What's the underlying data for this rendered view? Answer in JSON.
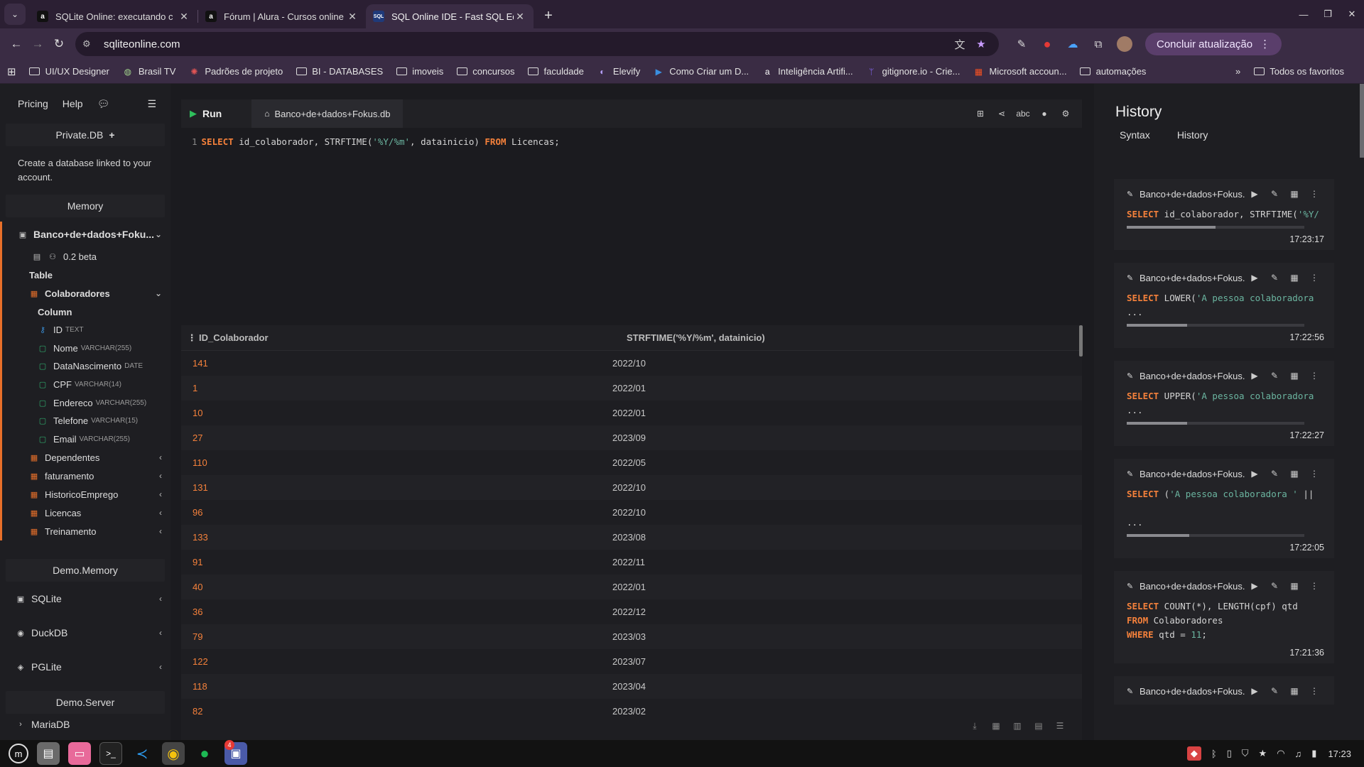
{
  "browser": {
    "tabs": [
      {
        "label": "SQLite Online: executando c",
        "favicon": "a",
        "active": false
      },
      {
        "label": "Fórum | Alura - Cursos online",
        "favicon": "a",
        "active": false
      },
      {
        "label": "SQL Online IDE - Fast SQL Ed",
        "favicon": "SQL",
        "active": true
      }
    ],
    "url": "sqliteonline.com",
    "update_button": "Concluir atualização",
    "bookmarks": [
      {
        "label": "UI/UX Designer",
        "icon": "folder-icon"
      },
      {
        "label": "Brasil TV",
        "icon": "tv-icon"
      },
      {
        "label": "Padrões de projeto",
        "icon": "pattern-icon"
      },
      {
        "label": "BI - DATABASES",
        "icon": "folder-icon"
      },
      {
        "label": "imoveis",
        "icon": "folder-icon"
      },
      {
        "label": "concursos",
        "icon": "folder-icon"
      },
      {
        "label": "faculdade",
        "icon": "folder-icon"
      },
      {
        "label": "Elevify",
        "icon": "elevify-icon"
      },
      {
        "label": "Como Criar um D...",
        "icon": "play-icon"
      },
      {
        "label": "Inteligência Artifi...",
        "icon": "alura-icon"
      },
      {
        "label": "gitignore.io - Crie...",
        "icon": "git-icon"
      },
      {
        "label": "Microsoft accoun...",
        "icon": "microsoft-icon"
      },
      {
        "label": "automações",
        "icon": "folder-icon"
      }
    ],
    "all_bookmarks": "Todos os favoritos"
  },
  "sidebar": {
    "top": {
      "pricing": "Pricing",
      "help": "Help"
    },
    "private_db": {
      "title": "Private.DB",
      "note": "Create a database linked to your account."
    },
    "memory": {
      "title": "Memory",
      "db_name": "Banco+de+dados+Foku...",
      "version": "0.2 beta",
      "table_heading": "Table",
      "open_table": "Colaboradores",
      "column_heading": "Column",
      "columns": [
        {
          "name": "ID",
          "type": "TEXT",
          "key": true
        },
        {
          "name": "Nome",
          "type": "VARCHAR(255)"
        },
        {
          "name": "DataNascimento",
          "type": "DATE"
        },
        {
          "name": "CPF",
          "type": "VARCHAR(14)"
        },
        {
          "name": "Endereco",
          "type": "VARCHAR(255)"
        },
        {
          "name": "Telefone",
          "type": "VARCHAR(15)"
        },
        {
          "name": "Email",
          "type": "VARCHAR(255)"
        }
      ],
      "other_tables": [
        "Dependentes",
        "faturamento",
        "HistoricoEmprego",
        "Licencas",
        "Treinamento"
      ]
    },
    "demo_memory": {
      "title": "Demo.Memory",
      "items": [
        "SQLite",
        "DuckDB",
        "PGLite"
      ]
    },
    "demo_server": {
      "title": "Demo.Server",
      "first_item": "MariaDB"
    }
  },
  "editor": {
    "run_label": "Run",
    "db_tab": "Banco+de+dados+Fokus.db",
    "line_no": "1",
    "query": {
      "kw1": "SELECT",
      "part1": " id_colaborador, STRFTIME(",
      "str1": "'%Y/%m'",
      "part2": ", datainicio) ",
      "kw2": "FROM",
      "part3": " Licencas;"
    }
  },
  "results": {
    "columns": [
      "ID_Colaborador",
      "STRFTIME('%Y/%m', datainicio)"
    ],
    "rows": [
      [
        "141",
        "2022/10"
      ],
      [
        "1",
        "2022/01"
      ],
      [
        "10",
        "2022/01"
      ],
      [
        "27",
        "2023/09"
      ],
      [
        "110",
        "2022/05"
      ],
      [
        "131",
        "2022/10"
      ],
      [
        "96",
        "2022/10"
      ],
      [
        "133",
        "2023/08"
      ],
      [
        "91",
        "2022/11"
      ],
      [
        "40",
        "2022/01"
      ],
      [
        "36",
        "2022/12"
      ],
      [
        "79",
        "2023/03"
      ],
      [
        "122",
        "2023/07"
      ],
      [
        "118",
        "2023/04"
      ],
      [
        "82",
        "2023/02"
      ]
    ]
  },
  "history": {
    "title": "History",
    "tabs": [
      "Syntax",
      "History"
    ],
    "items": [
      {
        "db": "Banco+de+dados+Fokus...",
        "lines": [
          [
            [
              "k",
              "SELECT"
            ],
            [
              "t",
              " id_colaborador, STRFTIME("
            ],
            [
              "s",
              "'%Y/"
            ]
          ]
        ],
        "time": "17:23:17",
        "progress": 0.5
      },
      {
        "db": "Banco+de+dados+Fokus...",
        "lines": [
          [
            [
              "k",
              "SELECT"
            ],
            [
              "t",
              " LOWER("
            ],
            [
              "s",
              "'A pessoa colaboradora"
            ]
          ],
          [
            [
              "t",
              "..."
            ]
          ]
        ],
        "time": "17:22:56",
        "progress": 0.34
      },
      {
        "db": "Banco+de+dados+Fokus...",
        "lines": [
          [
            [
              "k",
              "SELECT"
            ],
            [
              "t",
              " UPPER("
            ],
            [
              "s",
              "'A pessoa colaboradora"
            ]
          ],
          [
            [
              "t",
              "..."
            ]
          ]
        ],
        "time": "17:22:27",
        "progress": 0.34
      },
      {
        "db": "Banco+de+dados+Fokus...",
        "lines": [
          [
            [
              "k",
              "SELECT"
            ],
            [
              "t",
              " ("
            ],
            [
              "s",
              "'A pessoa colaboradora '"
            ],
            [
              "t",
              " ||"
            ]
          ],
          [
            [
              "t",
              ""
            ]
          ],
          [
            [
              "t",
              "..."
            ]
          ]
        ],
        "time": "17:22:05",
        "progress": 0.35
      },
      {
        "db": "Banco+de+dados+Fokus...",
        "lines": [
          [
            [
              "k",
              "SELECT"
            ],
            [
              "t",
              " COUNT(*), LENGTH(cpf) qtd"
            ]
          ],
          [
            [
              "k",
              "FROM"
            ],
            [
              "t",
              " Colaboradores"
            ]
          ],
          [
            [
              "k",
              "WHERE"
            ],
            [
              "t",
              " qtd = "
            ],
            [
              "n",
              "11"
            ],
            [
              "t",
              ";"
            ]
          ]
        ],
        "time": "17:21:36",
        "progress": 0
      },
      {
        "db": "Banco+de+dados+Fokus...",
        "lines": [],
        "time": "",
        "progress": 0
      }
    ]
  },
  "taskbar": {
    "clock": "17:23",
    "badge": "4"
  }
}
